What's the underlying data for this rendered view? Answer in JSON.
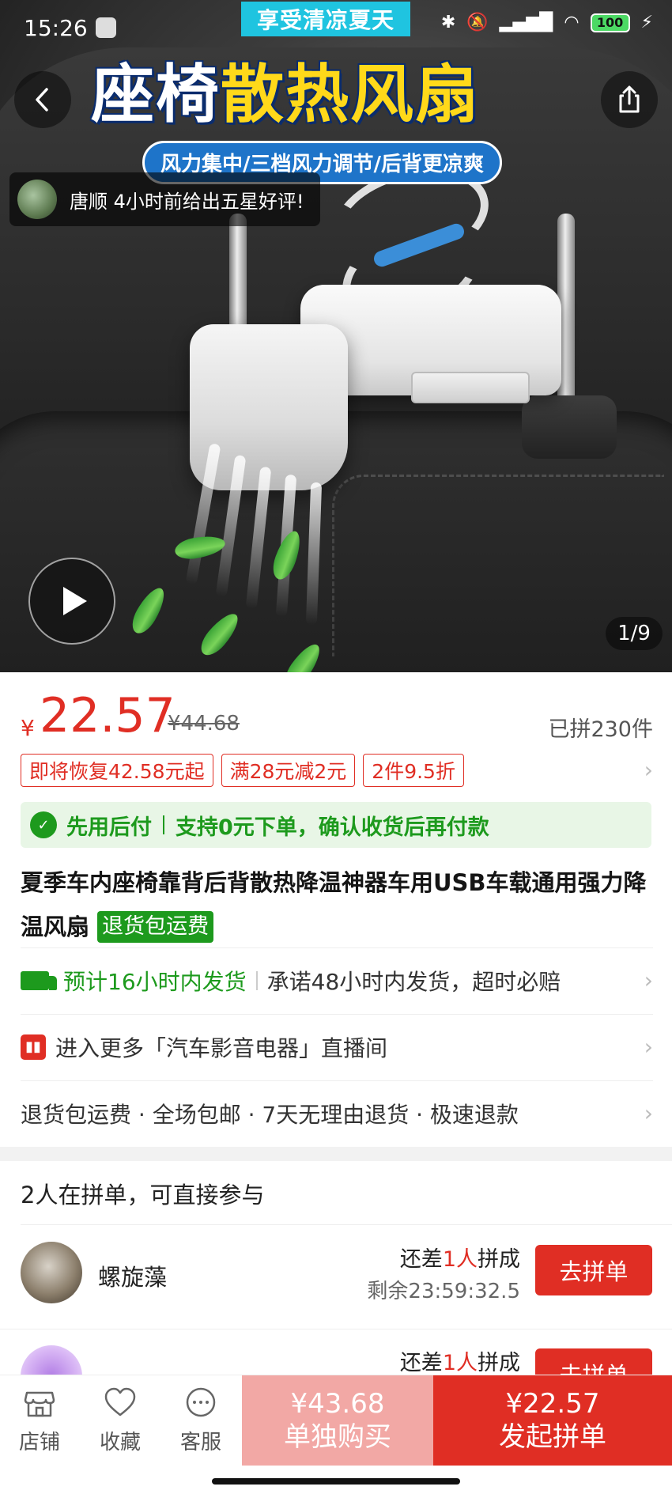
{
  "status_bar": {
    "time": "15:26",
    "battery": "100"
  },
  "hero": {
    "banner_top": "享受清凉夏天",
    "banner_main_white": "座椅",
    "banner_main_yellow": "散热风扇",
    "banner_sub": "风力集中/三档风力调节/后背更凉爽",
    "review_toast": "唐顺 4小时前给出五星好评!",
    "image_counter": "1/9"
  },
  "price": {
    "currency": "¥",
    "current": "22.57",
    "original": "¥44.68",
    "sold": "已拼230件"
  },
  "promos": [
    "即将恢复42.58元起",
    "满28元减2元",
    "2件9.5折"
  ],
  "paylater": {
    "label": "先用后付",
    "desc": "支持0元下单，确认收货后再付款"
  },
  "product": {
    "title": "夏季车内座椅靠背后背散热降温神器车用USB车载通用强力降温风扇",
    "badge": "退货包运费"
  },
  "shipping": {
    "estimate": "预计16小时内发货",
    "promise": "承诺48小时内发货，超时必赔"
  },
  "live": {
    "text": "进入更多「汽车影音电器」直播间"
  },
  "services": {
    "text": "退货包运费 · 全场包邮 · 7天无理由退货 · 极速退款"
  },
  "group_buy": {
    "title": "2人在拼单，可直接参与",
    "members": [
      {
        "name": "螺旋藻",
        "need_prefix": "还差",
        "need_count": "1人",
        "need_suffix": "拼成",
        "remain": "剩余23:59:32.5",
        "join": "去拼单"
      },
      {
        "name": "",
        "need_prefix": "还差",
        "need_count": "1人",
        "need_suffix": "拼成",
        "remain": "",
        "join": "去拼单"
      }
    ]
  },
  "bottom_bar": {
    "store": "店铺",
    "favorite": "收藏",
    "service": "客服",
    "buy_alone_price": "¥43.68",
    "buy_alone_label": "单独购买",
    "buy_group_price": "¥22.57",
    "buy_group_label": "发起拼单"
  },
  "colors": {
    "accent": "#e02e24",
    "green": "#1d9a1d",
    "banner_blue": "#1e74c9",
    "banner_yellow": "#ffd91a"
  }
}
